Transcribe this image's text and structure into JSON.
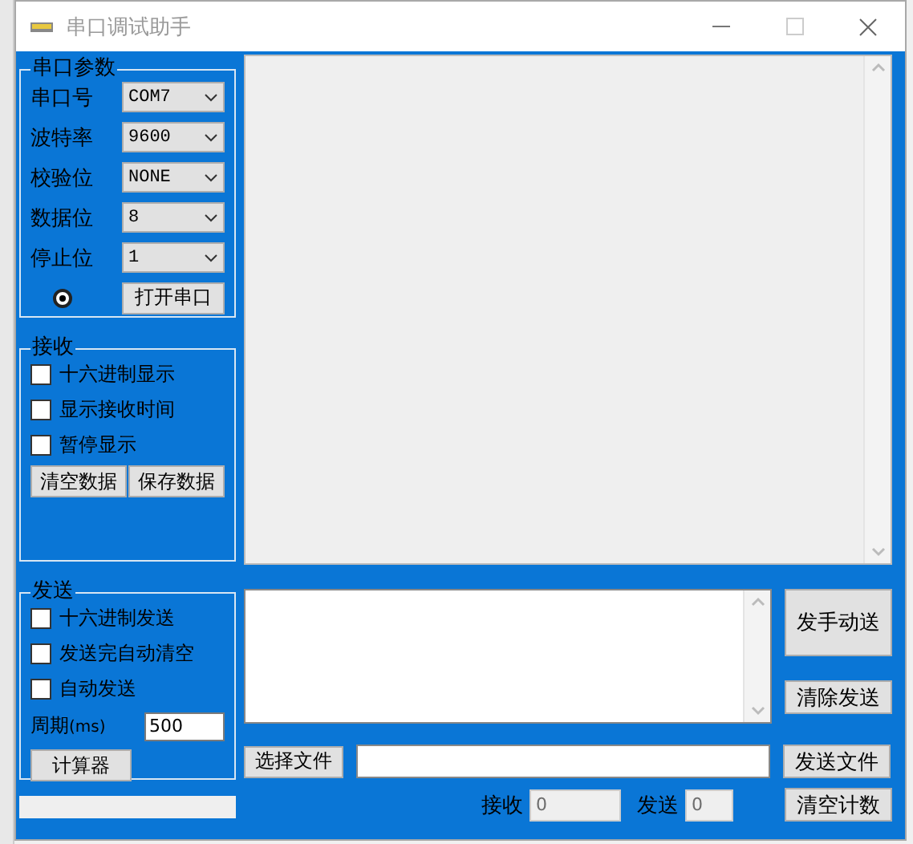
{
  "window": {
    "title": "串口调试助手"
  },
  "port_settings": {
    "title": "串口参数",
    "fields": [
      {
        "label": "串口号",
        "value": "COM7"
      },
      {
        "label": "波特率",
        "value": "9600"
      },
      {
        "label": "校验位",
        "value": "NONE"
      },
      {
        "label": "数据位",
        "value": "8"
      },
      {
        "label": "停止位",
        "value": "1"
      }
    ],
    "port_open": false,
    "open_button": "打开串口"
  },
  "receive": {
    "title": "接收",
    "options": [
      {
        "label": "十六进制显示",
        "checked": false
      },
      {
        "label": "显示接收时间",
        "checked": false
      },
      {
        "label": "暂停显示",
        "checked": false
      }
    ],
    "buttons": [
      "清空数据",
      "保存数据"
    ]
  },
  "send": {
    "title": "发送",
    "options": [
      {
        "label": "十六进制发送",
        "checked": false
      },
      {
        "label": "发送完自动清空",
        "checked": false
      },
      {
        "label": "自动发送",
        "checked": false
      }
    ],
    "period": {
      "label": "周期",
      "unit": "(ms)",
      "value": "500"
    },
    "calculator_button": "计算器"
  },
  "send_buttons": [
    "发手动送",
    "清除发送"
  ],
  "file": {
    "choose_button": "选择文件",
    "send_button": "发送文件"
  },
  "counters": [
    {
      "label": "接收",
      "value": "0"
    },
    {
      "label": "发送",
      "value": "0"
    }
  ],
  "clear_count_button": "清空计数"
}
